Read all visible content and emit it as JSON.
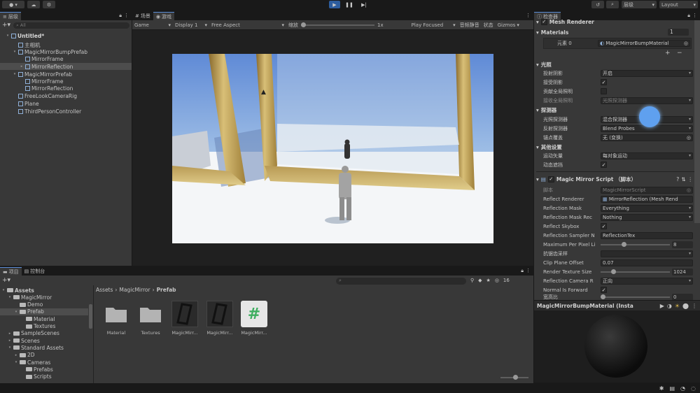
{
  "colors": {
    "accent": "#5a8cd6",
    "play": "#2d5d9e",
    "script_hash": "#3dae5f"
  },
  "toolbar": {
    "account_icon": "account-icon",
    "cloud_icon": "cloud-icon",
    "settings_icon": "collab-icon",
    "history_icon": "history-icon",
    "search_icon": "search-icon",
    "layers_label": "层级",
    "layout_label": "Layout"
  },
  "hierarchy": {
    "tab_label": "层级",
    "search_placeholder": "All",
    "items": [
      {
        "label": "Untitled*",
        "depth": 0
      },
      {
        "label": "主相机",
        "depth": 1
      },
      {
        "label": "MagicMirrorBumpPrefab",
        "depth": 1
      },
      {
        "label": "MirrorFrame",
        "depth": 2
      },
      {
        "label": "MirrorReflection",
        "depth": 2
      },
      {
        "label": "MagicMirrorPrefab",
        "depth": 1
      },
      {
        "label": "MirrorFrame",
        "depth": 2
      },
      {
        "label": "MirrorReflection",
        "depth": 2
      },
      {
        "label": "FreeLookCameraRig",
        "depth": 1
      },
      {
        "label": "Plane",
        "depth": 1
      },
      {
        "label": "ThirdPersonController",
        "depth": 1
      }
    ]
  },
  "center_tabs": {
    "scene": "场景",
    "game": "游戏"
  },
  "game_toolbar": {
    "mode": "Game",
    "display": "Display 1",
    "aspect": "Free Aspect",
    "scale_label": "缩放",
    "scale_value": "1x",
    "play_focused": "Play Focused",
    "mute": "音频静音",
    "stats": "状态",
    "gizmos": "Gizmos"
  },
  "inspector": {
    "tab_label": "检查器",
    "component_title": "Mesh Renderer",
    "materials_label": "Materials",
    "materials_count": "1",
    "element_label": "元素 0",
    "element_value": "MagicMirrorBumpMaterial",
    "lighting_header": "光照",
    "cast_shadows_label": "投射阴影",
    "cast_shadows_value": "开启",
    "receive_shadows_label": "接受阴影",
    "contribute_gi_label": "贡献全局照明",
    "receive_gi_label": "接收全局照明",
    "receive_gi_value": "光照探测器",
    "probes_header": "探测器",
    "light_probes_label": "光照探测器",
    "light_probes_value": "混合探测器",
    "reflection_probes_label": "反射探测器",
    "reflection_probes_value": "Blend Probes",
    "anchor_label": "锚点覆盖",
    "anchor_value": "无 (变换)",
    "additional_header": "其他设置",
    "motion_vectors_label": "运动矢量",
    "motion_vectors_value": "每对象运动",
    "dynamic_occlusion_label": "动态遮挡",
    "script_title": "Magic Mirror Script （脚本）",
    "script_label": "脚本",
    "script_value": "MagicMirrorScript",
    "reflect_renderer_label": "Reflect Renderer",
    "reflect_renderer_value": "MirrorReflection (Mesh Rend",
    "reflection_mask_label": "Reflection Mask",
    "reflection_mask_value": "Everything",
    "reflection_mask_rec_label": "Reflection Mask Rec",
    "reflection_mask_rec_value": "Nothing",
    "reflect_skybox_label": "Reflect Skybox",
    "sampler_label": "Reflection Sampler N",
    "sampler_value": "ReflectionTex",
    "max_per_pixel_label": "Maximum Per Pixel Li",
    "max_per_pixel_value": "8",
    "max_per_pixel_level": 0.3,
    "aa_label": "抗锯齿采样",
    "clip_plane_label": "Clip Plane Offset",
    "clip_plane_value": "0.07",
    "render_size_label": "Render Texture Size",
    "render_size_value": "1024",
    "render_size_level": 0.15,
    "camera_label": "Reflection Camera R",
    "camera_value": "正向",
    "normal_label": "Normal Is Forward",
    "ratio_label": "宽高比",
    "ratio_value": "0",
    "preview_title": "MagicMirrorBumpMaterial (Insta"
  },
  "project": {
    "tab_project": "项目",
    "tab_console": "控制台",
    "tree": [
      {
        "label": "Assets",
        "depth": 0
      },
      {
        "label": "MagicMirror",
        "depth": 1
      },
      {
        "label": "Demo",
        "depth": 2
      },
      {
        "label": "Prefab",
        "depth": 2
      },
      {
        "label": "Material",
        "depth": 3
      },
      {
        "label": "Textures",
        "depth": 3
      },
      {
        "label": "SampleScenes",
        "depth": 1
      },
      {
        "label": "Scenes",
        "depth": 1
      },
      {
        "label": "Standard Assets",
        "depth": 1
      },
      {
        "label": "2D",
        "depth": 2
      },
      {
        "label": "Cameras",
        "depth": 2
      },
      {
        "label": "Prefabs",
        "depth": 3
      },
      {
        "label": "Scripts",
        "depth": 3
      }
    ],
    "breadcrumb": [
      "Assets",
      "MagicMirror",
      "Prefab"
    ],
    "hidden_count": "16",
    "assets": [
      {
        "label": "Material",
        "type": "folder"
      },
      {
        "label": "Textures",
        "type": "folder"
      },
      {
        "label": "MagicMirr...",
        "type": "prefab"
      },
      {
        "label": "MagicMirr...",
        "type": "prefab"
      },
      {
        "label": "MagicMirr...",
        "type": "script"
      }
    ]
  }
}
